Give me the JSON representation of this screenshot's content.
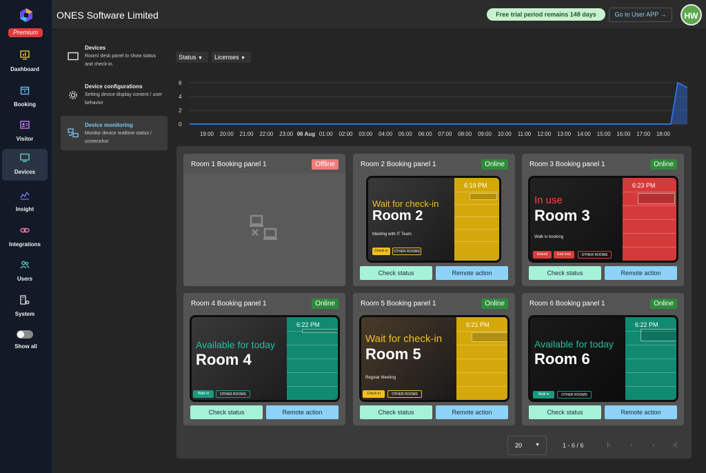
{
  "sidebar": {
    "premium": "Premium",
    "items": [
      {
        "label": "Dashboard",
        "icon": "monitor-chart-icon"
      },
      {
        "label": "Booking",
        "icon": "calendar-icon"
      },
      {
        "label": "Visitor",
        "icon": "id-card-icon"
      },
      {
        "label": "Devices",
        "icon": "monitor-icon"
      },
      {
        "label": "Insight",
        "icon": "insight-chart-icon"
      },
      {
        "label": "Integrations",
        "icon": "link-icon"
      },
      {
        "label": "Users",
        "icon": "users-icon"
      },
      {
        "label": "System",
        "icon": "building-gear-icon"
      }
    ],
    "show_all": "Show all",
    "accent": "#e03a3a"
  },
  "header": {
    "company": "ONES Software Limited",
    "trial": "Free trial period remains 148 days",
    "go_user": "Go to User APP",
    "avatar": "HW"
  },
  "submenu": [
    {
      "title": "Devices",
      "desc": "Room/ desk panel to show status and check-in."
    },
    {
      "title": "Device configurations",
      "desc": "Setting device display content / user behavior"
    },
    {
      "title": "Device monitoring",
      "desc": "Monitor device realtime status / screenshot"
    }
  ],
  "filters": {
    "status": "Status",
    "licenses": "Licenses"
  },
  "chart_data": {
    "type": "area",
    "x": [
      "19:00",
      "20:00",
      "21:00",
      "22:00",
      "23:00",
      "06 Aug",
      "01:00",
      "02:00",
      "03:00",
      "04:00",
      "05:00",
      "06:00",
      "07:00",
      "08:00",
      "09:00",
      "10:00",
      "11:00",
      "12:00",
      "13:00",
      "14:00",
      "15:00",
      "16:00",
      "17:00",
      "18:00"
    ],
    "y_ticks": [
      0,
      2,
      4,
      6
    ],
    "ylim": [
      0,
      6
    ],
    "series": [
      {
        "values": [
          0,
          0,
          0,
          0,
          0,
          0,
          0,
          0,
          0,
          0,
          0,
          0,
          0,
          0,
          0,
          0,
          0,
          0,
          0,
          0,
          0,
          0,
          0,
          6,
          5.3
        ]
      }
    ],
    "grid": true,
    "color": "#2f6fe0"
  },
  "cards": [
    {
      "title": "Room 1 Booking panel 1",
      "status": "Offline"
    },
    {
      "title": "Room 2 Booking panel 1",
      "status": "Online",
      "screen_status": "Wait for check-in",
      "room": "Room 2",
      "time": "6:19 PM",
      "meeting": "Meeting with IT Team",
      "btn1": "Check in",
      "btn2": "OTHER ROOMS"
    },
    {
      "title": "Room 3 Booking panel 1",
      "status": "Online",
      "screen_status": "In use",
      "room": "Room 3",
      "time": "6:23 PM",
      "meeting": "Walk in booking",
      "btn1": "Extend",
      "btn2": "End now",
      "btn3": "OTHER ROOMS"
    },
    {
      "title": "Room 4 Booking panel 1",
      "status": "Online",
      "screen_status": "Available for today",
      "room": "Room 4",
      "time": "6:22 PM",
      "btn1": "Walk in",
      "btn2": "OTHER ROOMS"
    },
    {
      "title": "Room 5 Booking panel 1",
      "status": "Online",
      "screen_status": "Wait for check-in",
      "room": "Room 5",
      "time": "6:21 PM",
      "meeting": "Regular Meeting",
      "btn1": "Check in",
      "btn2": "OTHER ROOMS"
    },
    {
      "title": "Room 6 Booking panel 1",
      "status": "Online",
      "screen_status": "Available for today",
      "room": "Room 6",
      "time": "6:22 PM",
      "btn1": "Walk in",
      "btn2": "OTHER ROOMS"
    }
  ],
  "actions": {
    "check": "Check status",
    "remote": "Remote action"
  },
  "pagination": {
    "per_page": "20",
    "range": "1 - 6 / 6"
  }
}
